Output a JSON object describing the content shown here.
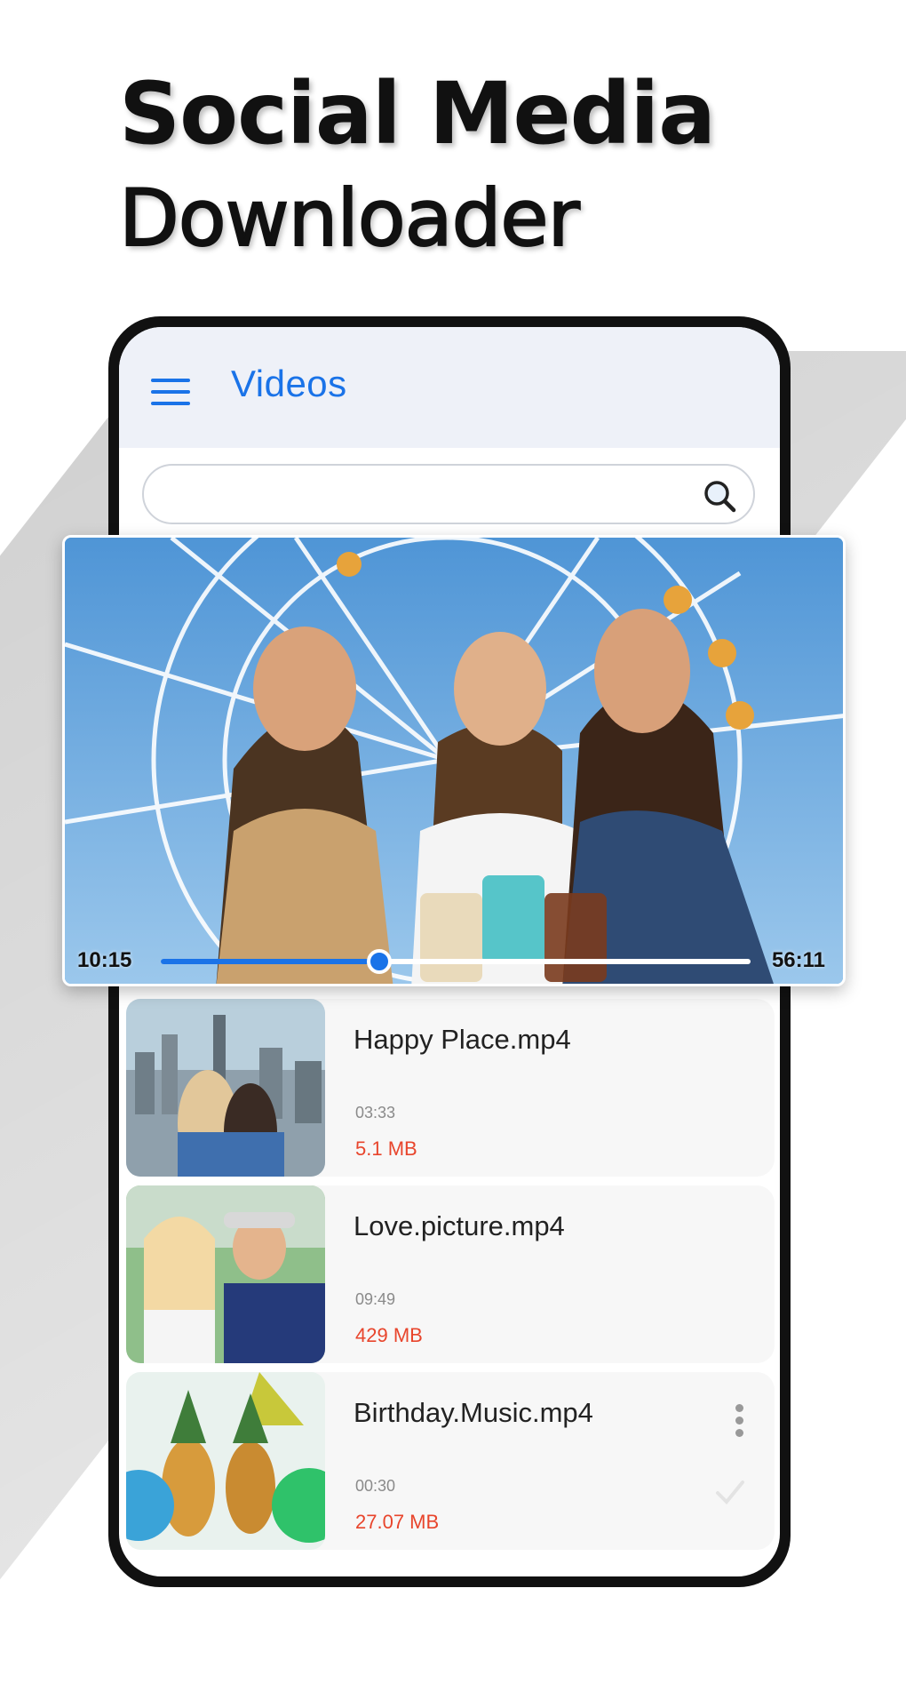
{
  "headline": {
    "line1": "Social Media",
    "line2": "Downloader"
  },
  "app": {
    "title": "Videos",
    "search": {
      "value": "",
      "placeholder": ""
    }
  },
  "player": {
    "current_time": "10:15",
    "total_time": "56:11",
    "progress": 0.37
  },
  "videos": [
    {
      "name": "Happy Place.mp4",
      "duration": "03:33",
      "size": "5.1 MB"
    },
    {
      "name": "Love.picture.mp4",
      "duration": "09:49",
      "size": "429 MB"
    },
    {
      "name": "Birthday.Music.mp4",
      "duration": "00:30",
      "size": "27.07 MB"
    }
  ],
  "colors": {
    "accent": "#1a73e8",
    "size_text": "#e8452c",
    "appbar_bg": "#eef1f8"
  },
  "icons": {
    "menu": "hamburger-menu-icon",
    "search": "search-icon",
    "more": "more-vert-icon",
    "check": "check-icon"
  }
}
